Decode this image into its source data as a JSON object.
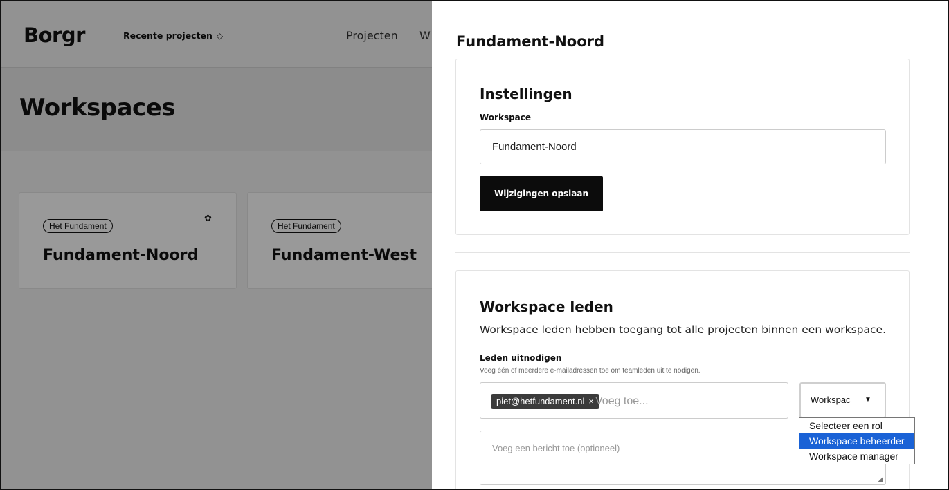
{
  "app": {
    "logo": "Borgr",
    "recent_projects": "Recente projecten",
    "recent_chevron": "◇",
    "nav": [
      "Projecten",
      "W"
    ],
    "page_title": "Workspaces"
  },
  "cards": [
    {
      "tag": "Het Fundament",
      "title": "Fundament-Noord",
      "gear": "✿"
    },
    {
      "tag": "Het Fundament",
      "title": "Fundament-West"
    }
  ],
  "panel": {
    "title": "Fundament-Noord",
    "settings": {
      "heading": "Instellingen",
      "workspace_label": "Workspace",
      "workspace_value": "Fundament-Noord",
      "save_label": "Wijzigingen opslaan"
    },
    "members": {
      "heading": "Workspace leden",
      "description": "Workspace leden hebben toegang tot alle projecten binnen een workspace.",
      "invite_label": "Leden uitnodigen",
      "invite_hint": "Voeg één of meerdere e-mailadressen toe om teamleden uit te nodigen.",
      "chip_email": "piet@hetfundament.nl",
      "chip_remove": "×",
      "add_placeholder": "Voeg toe...",
      "role_value": "Workspac",
      "role_arrow": "▼",
      "message_placeholder": "Voeg een bericht toe (optioneel)",
      "resize_grip": "◢",
      "role_options": [
        "Selecteer een rol",
        "Workspace beheerder",
        "Workspace manager"
      ],
      "selected_option_index": 1
    }
  },
  "colors": {
    "accent_selected": "#1a62d6",
    "primary_button": "#0c0c0c"
  }
}
